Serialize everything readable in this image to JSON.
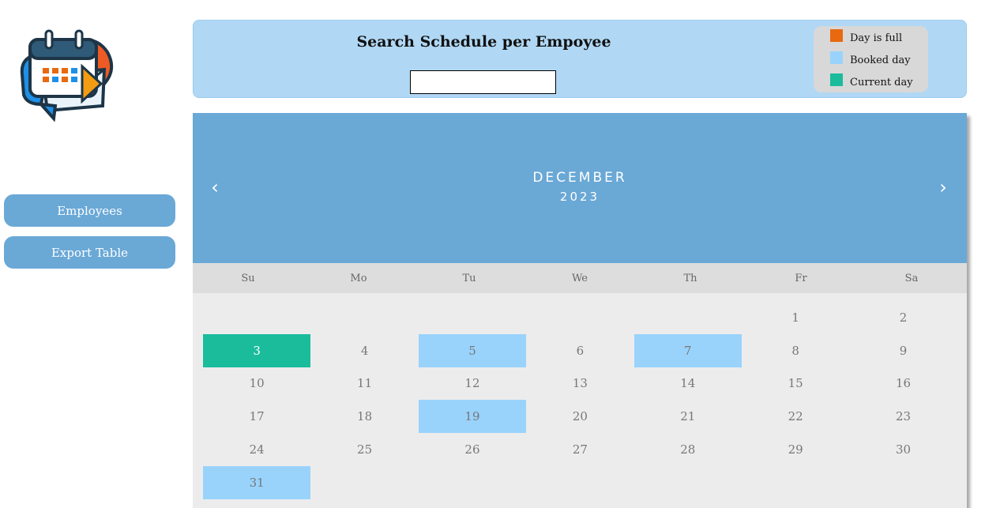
{
  "sidebar": {
    "buttons": [
      {
        "label": "Employees"
      },
      {
        "label": "Export Table"
      }
    ]
  },
  "search": {
    "title": "Search Schedule per Empoyee",
    "input_value": "",
    "placeholder": ""
  },
  "legend": {
    "items": [
      {
        "label": "Day is full",
        "color": "#e8690f"
      },
      {
        "label": "Booked day",
        "color": "#99d3fc"
      },
      {
        "label": "Current day",
        "color": "#1abc9c"
      }
    ]
  },
  "calendar": {
    "prev_icon": "‹",
    "next_icon": "›",
    "month": "DECEMBER",
    "year": "2023",
    "weekdays": [
      "Su",
      "Mo",
      "Tu",
      "We",
      "Th",
      "Fr",
      "Sa"
    ],
    "days": [
      {
        "n": ""
      },
      {
        "n": ""
      },
      {
        "n": ""
      },
      {
        "n": ""
      },
      {
        "n": ""
      },
      {
        "n": "1"
      },
      {
        "n": "2"
      },
      {
        "n": "3",
        "status": "current"
      },
      {
        "n": "4"
      },
      {
        "n": "5",
        "status": "booked"
      },
      {
        "n": "6"
      },
      {
        "n": "7",
        "status": "booked"
      },
      {
        "n": "8"
      },
      {
        "n": "9"
      },
      {
        "n": "10"
      },
      {
        "n": "11"
      },
      {
        "n": "12"
      },
      {
        "n": "13"
      },
      {
        "n": "14"
      },
      {
        "n": "15"
      },
      {
        "n": "16"
      },
      {
        "n": "17"
      },
      {
        "n": "18"
      },
      {
        "n": "19",
        "status": "booked"
      },
      {
        "n": "20"
      },
      {
        "n": "21"
      },
      {
        "n": "22"
      },
      {
        "n": "23"
      },
      {
        "n": "24"
      },
      {
        "n": "25"
      },
      {
        "n": "26"
      },
      {
        "n": "27"
      },
      {
        "n": "28"
      },
      {
        "n": "29"
      },
      {
        "n": "30"
      },
      {
        "n": "31",
        "status": "booked"
      }
    ]
  }
}
